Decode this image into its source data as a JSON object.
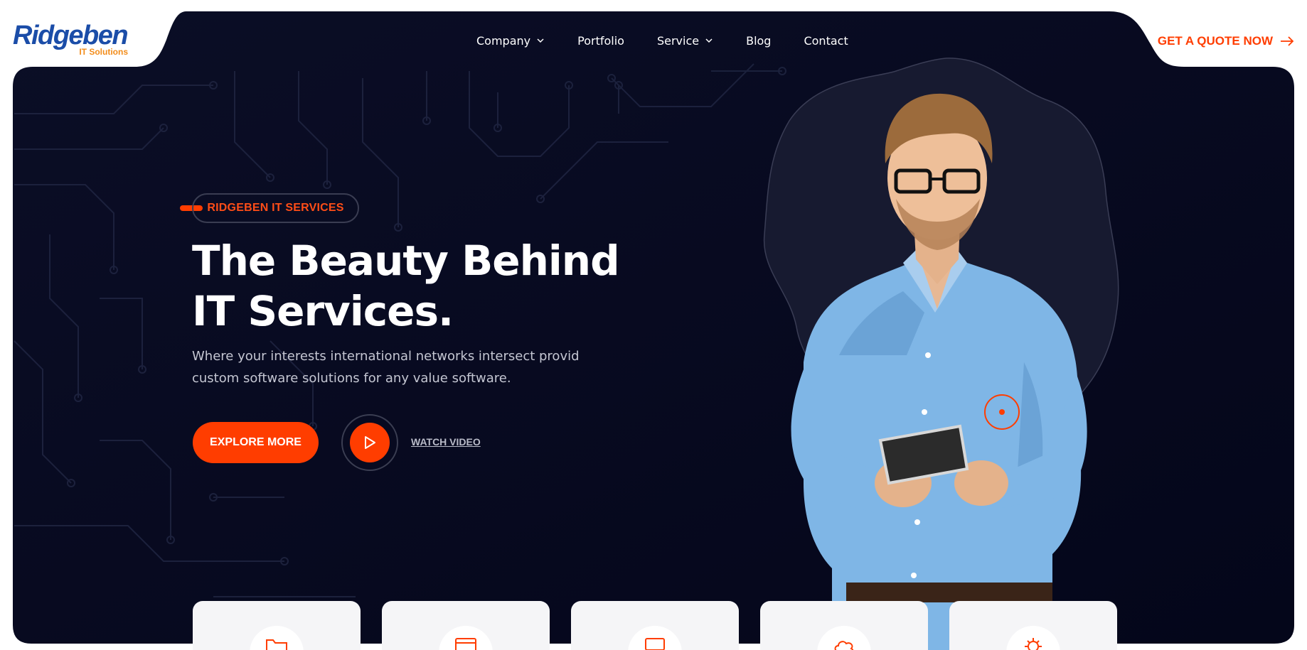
{
  "brand": {
    "name": "Ridgeben",
    "tagline": "IT Solutions"
  },
  "nav": {
    "items": [
      {
        "label": "Company",
        "has_dropdown": true
      },
      {
        "label": "Portfolio",
        "has_dropdown": false
      },
      {
        "label": "Service",
        "has_dropdown": true
      },
      {
        "label": "Blog",
        "has_dropdown": false
      },
      {
        "label": "Contact",
        "has_dropdown": false
      }
    ],
    "cta_label": "GET A QUOTE NOW"
  },
  "hero": {
    "badge": "RIDGEBEN IT SERVICES",
    "headline": [
      "The Beauty Behind",
      "IT Services."
    ],
    "lead": [
      "Where your interests international networks intersect provid",
      "custom software solutions for any value software."
    ],
    "explore_label": "EXPLORE MORE",
    "watch_label": "WATCH VIDEO"
  },
  "service_cards": [
    {
      "icon": "folder-icon"
    },
    {
      "icon": "browser-window-icon"
    },
    {
      "icon": "monitor-icon"
    },
    {
      "icon": "cloud-icon"
    },
    {
      "icon": "gear-cog-icon"
    }
  ],
  "colors": {
    "hero_bg": "#070a1e",
    "accent": "#ff3d00",
    "logo_blue": "#1b4da8",
    "logo_orange": "#f28c1a"
  }
}
